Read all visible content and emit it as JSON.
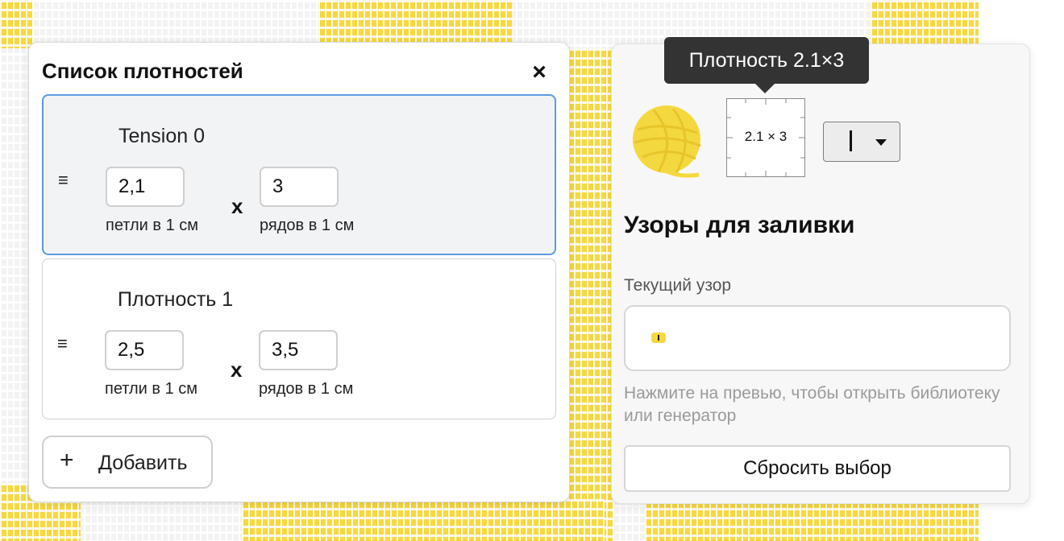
{
  "density_list": {
    "title": "Список плотностей",
    "close_icon": "×",
    "tensions": [
      {
        "name": "Tension 0",
        "stitches": "2,1",
        "rows": "3",
        "stitches_unit": "петли в 1 см",
        "rows_unit": "рядов в 1 см",
        "active": true
      },
      {
        "name": "Плотность 1",
        "stitches": "2,5",
        "rows": "3,5",
        "stitches_unit": "петли в 1 см",
        "rows_unit": "рядов в 1 см",
        "active": false
      }
    ],
    "times_symbol": "x",
    "drag_icon": "≡",
    "add_icon": "+",
    "add_label": "Добавить"
  },
  "tooltip": {
    "text": "Плотность 2.1×3"
  },
  "gauge": {
    "label": "2.1 × 3"
  },
  "fill_patterns": {
    "title": "Узоры для заливки",
    "current_label": "Текущий узор",
    "hint": "Нажмите на превью, чтобы открыть библиотеку или генератор",
    "reset_label": "Сбросить выбор"
  },
  "colors": {
    "yarn": "#f4d83f",
    "accent_border": "#5b9be0",
    "tooltip_bg": "#333333"
  },
  "icons": {
    "yarn": "yarn-ball-icon",
    "needle": "needle-icon",
    "dropdown": "chevron-down-icon",
    "stitch": "stitch-icon"
  }
}
